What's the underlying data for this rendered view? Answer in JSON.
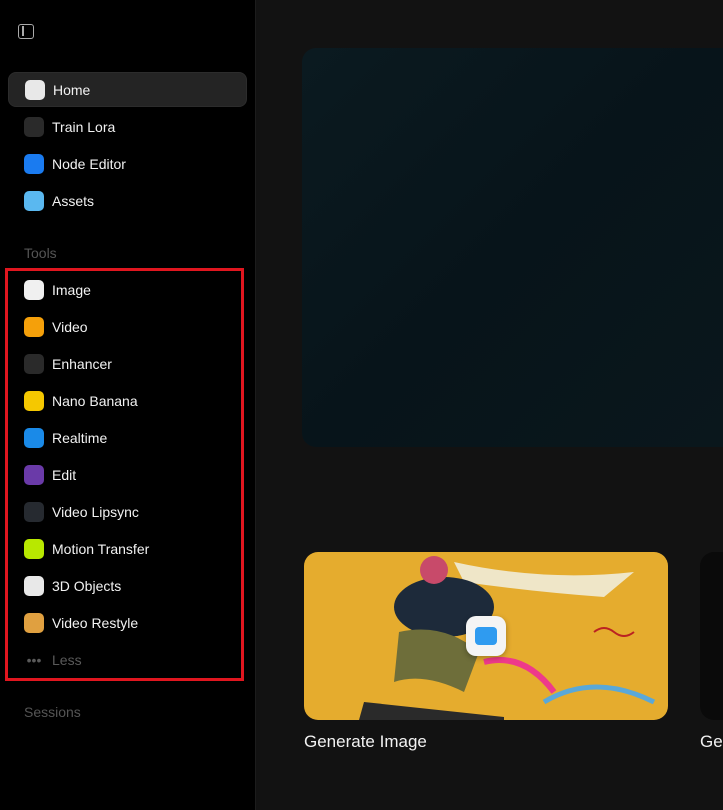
{
  "sidebar": {
    "main": [
      {
        "label": "Home",
        "icon": "home-icon",
        "color": "#e8e8e8"
      },
      {
        "label": "Train Lora",
        "icon": "color-wheel-icon",
        "color": "#2a2a2a"
      },
      {
        "label": "Node Editor",
        "icon": "node-icon",
        "color": "#1a7bf0"
      },
      {
        "label": "Assets",
        "icon": "folder-icon",
        "color": "#5ab8f0"
      }
    ],
    "tools_heading": "Tools",
    "tools": [
      {
        "label": "Image",
        "icon": "image-icon",
        "color": "#f0f0f0"
      },
      {
        "label": "Video",
        "icon": "video-camera-icon",
        "color": "#f5a00a"
      },
      {
        "label": "Enhancer",
        "icon": "magic-wand-icon",
        "color": "#2a2a2a"
      },
      {
        "label": "Nano Banana",
        "icon": "banana-icon",
        "color": "#f5c800"
      },
      {
        "label": "Realtime",
        "icon": "pen-icon",
        "color": "#1a8ae8"
      },
      {
        "label": "Edit",
        "icon": "compass-icon",
        "color": "#6a3aa8"
      },
      {
        "label": "Video Lipsync",
        "icon": "microphone-icon",
        "color": "#262a30"
      },
      {
        "label": "Motion Transfer",
        "icon": "person-icon",
        "color": "#b8e800"
      },
      {
        "label": "3D Objects",
        "icon": "cube-icon",
        "color": "#e8e8e8"
      },
      {
        "label": "Video Restyle",
        "icon": "film-icon",
        "color": "#e0a040"
      }
    ],
    "less_label": "Less",
    "sessions_heading": "Sessions"
  },
  "main": {
    "cards": [
      {
        "label": "Generate Image"
      },
      {
        "label": "Ge"
      }
    ]
  }
}
